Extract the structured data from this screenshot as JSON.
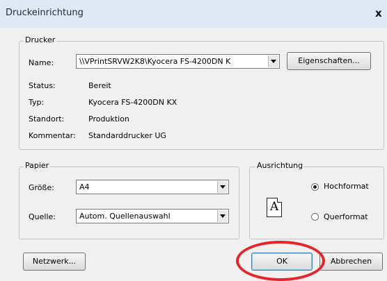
{
  "window": {
    "title": "Druckeinrichtung",
    "close_label": "x"
  },
  "printer_group": {
    "legend": "Drucker",
    "name_label": "Name:",
    "name_value": "\\\\VPrintSRVW2K8\\Kyocera FS-4200DN K",
    "properties_button": "Eigenschaften...",
    "status_label": "Status:",
    "status_value": "Bereit",
    "type_label": "Typ:",
    "type_value": "Kyocera FS-4200DN KX",
    "location_label": "Standort:",
    "location_value": "Produktion",
    "comment_label": "Kommentar:",
    "comment_value": "Standarddrucker UG"
  },
  "paper_group": {
    "legend": "Papier",
    "size_label": "Größe:",
    "size_value": "A4",
    "source_label": "Quelle:",
    "source_value": "Autom. Quellenauswahl"
  },
  "orientation_group": {
    "legend": "Ausrichtung",
    "icon_glyph": "A",
    "portrait_label": "Hochformat",
    "landscape_label": "Querformat",
    "selected": "Hochformat"
  },
  "buttons": {
    "network": "Netzwerk...",
    "ok": "OK",
    "cancel": "Abbrechen"
  },
  "annotation": {
    "color": "#e3262a",
    "target": "ok-button"
  },
  "colors": {
    "titlebar": "#dfe9f6",
    "dialog_bg": "#f0f0f0"
  }
}
